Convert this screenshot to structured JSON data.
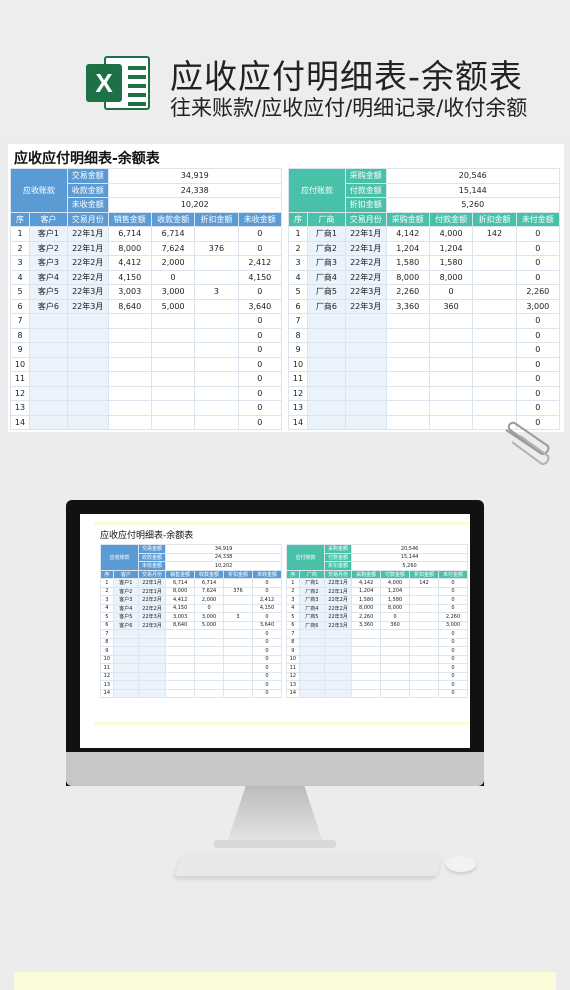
{
  "header": {
    "logo_letter": "X",
    "title": "应收应付明细表-余额表",
    "subtitle": "往来账款/应收应付/明细记录/收付余额"
  },
  "sheet": {
    "title": "应收应付明细表-余额表",
    "receivable": {
      "group_label": "应收账款",
      "summary": [
        {
          "label": "交易金额",
          "value": "34,919"
        },
        {
          "label": "收款金额",
          "value": "24,338"
        },
        {
          "label": "未收金额",
          "value": "10,202"
        }
      ],
      "columns": [
        "序",
        "客户",
        "交易月份",
        "销售金额",
        "收款金额",
        "折扣金额",
        "未收金额"
      ],
      "rows": [
        [
          "1",
          "客户1",
          "22年1月",
          "6,714",
          "6,714",
          "",
          "0"
        ],
        [
          "2",
          "客户2",
          "22年1月",
          "8,000",
          "7,624",
          "376",
          "0"
        ],
        [
          "3",
          "客户3",
          "22年2月",
          "4,412",
          "2,000",
          "",
          "2,412"
        ],
        [
          "4",
          "客户4",
          "22年2月",
          "4,150",
          "0",
          "",
          "4,150"
        ],
        [
          "5",
          "客户5",
          "22年3月",
          "3,003",
          "3,000",
          "3",
          "0"
        ],
        [
          "6",
          "客户6",
          "22年3月",
          "8,640",
          "5,000",
          "",
          "3,640"
        ],
        [
          "7",
          "",
          "",
          "",
          "",
          "",
          "0"
        ],
        [
          "8",
          "",
          "",
          "",
          "",
          "",
          "0"
        ],
        [
          "9",
          "",
          "",
          "",
          "",
          "",
          "0"
        ],
        [
          "10",
          "",
          "",
          "",
          "",
          "",
          "0"
        ],
        [
          "11",
          "",
          "",
          "",
          "",
          "",
          "0"
        ],
        [
          "12",
          "",
          "",
          "",
          "",
          "",
          "0"
        ],
        [
          "13",
          "",
          "",
          "",
          "",
          "",
          "0"
        ],
        [
          "14",
          "",
          "",
          "",
          "",
          "",
          "0"
        ]
      ]
    },
    "payable": {
      "group_label": "应付账款",
      "summary": [
        {
          "label": "采购金额",
          "value": "20,546"
        },
        {
          "label": "付款金额",
          "value": "15,144"
        },
        {
          "label": "折扣金额",
          "value": "5,260"
        }
      ],
      "columns": [
        "序",
        "厂商",
        "交易月份",
        "采购金额",
        "付款金额",
        "折扣金额",
        "未付金额"
      ],
      "rows": [
        [
          "1",
          "厂商1",
          "22年1月",
          "4,142",
          "4,000",
          "142",
          "0"
        ],
        [
          "2",
          "厂商2",
          "22年1月",
          "1,204",
          "1,204",
          "",
          "0"
        ],
        [
          "3",
          "厂商3",
          "22年2月",
          "1,580",
          "1,580",
          "",
          "0"
        ],
        [
          "4",
          "厂商4",
          "22年2月",
          "8,000",
          "8,000",
          "",
          "0"
        ],
        [
          "5",
          "厂商5",
          "22年3月",
          "2,260",
          "0",
          "",
          "2,260"
        ],
        [
          "6",
          "厂商6",
          "22年3月",
          "3,360",
          "360",
          "",
          "3,000"
        ],
        [
          "7",
          "",
          "",
          "",
          "",
          "",
          "0"
        ],
        [
          "8",
          "",
          "",
          "",
          "",
          "",
          "0"
        ],
        [
          "9",
          "",
          "",
          "",
          "",
          "",
          "0"
        ],
        [
          "10",
          "",
          "",
          "",
          "",
          "",
          "0"
        ],
        [
          "11",
          "",
          "",
          "",
          "",
          "",
          "0"
        ],
        [
          "12",
          "",
          "",
          "",
          "",
          "",
          "0"
        ],
        [
          "13",
          "",
          "",
          "",
          "",
          "",
          "0"
        ],
        [
          "14",
          "",
          "",
          "",
          "",
          "",
          "0"
        ]
      ]
    }
  },
  "colors": {
    "receivable_accent": "#5b9bd5",
    "payable_accent": "#48c1a8",
    "excel_green": "#1e7145"
  }
}
